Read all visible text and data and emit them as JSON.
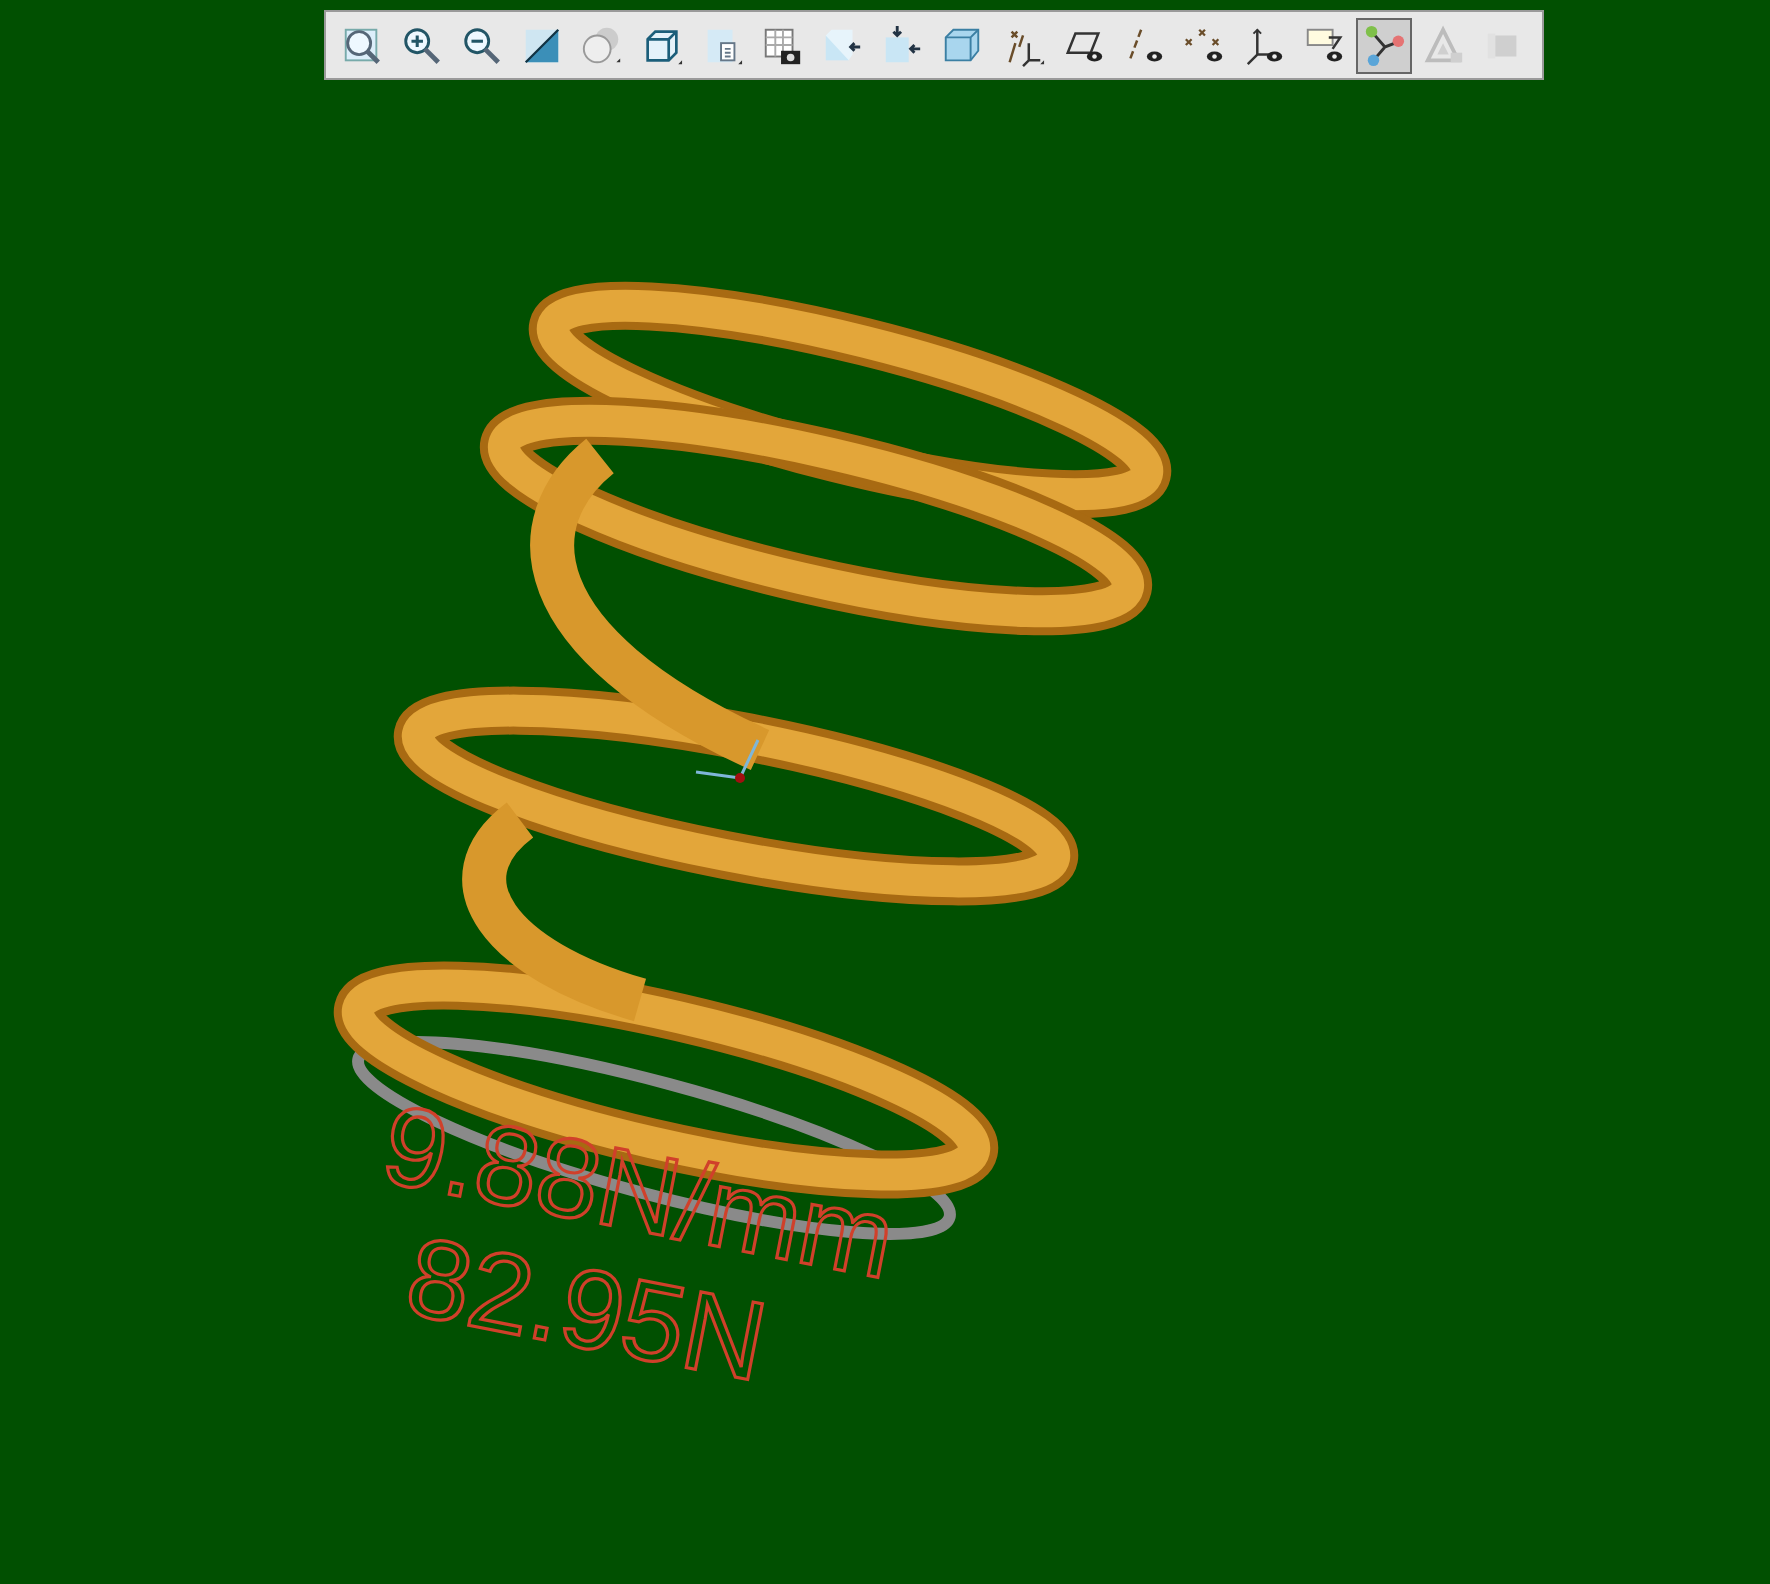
{
  "toolbar": {
    "buttons": [
      {
        "kind": "zoom-fit",
        "selected": false,
        "disabled": false
      },
      {
        "kind": "zoom-in",
        "selected": false,
        "disabled": false
      },
      {
        "kind": "zoom-out",
        "selected": false,
        "disabled": false
      },
      {
        "kind": "refit",
        "selected": false,
        "disabled": false
      },
      {
        "kind": "shading",
        "selected": false,
        "disabled": false
      },
      {
        "kind": "cube",
        "selected": false,
        "disabled": false
      },
      {
        "kind": "page",
        "selected": false,
        "disabled": false
      },
      {
        "kind": "table-camera",
        "selected": false,
        "disabled": false
      },
      {
        "kind": "cube-arrow",
        "selected": false,
        "disabled": false
      },
      {
        "kind": "cube-arrows",
        "selected": false,
        "disabled": false
      },
      {
        "kind": "glass-cube",
        "selected": false,
        "disabled": false
      },
      {
        "kind": "axes",
        "selected": false,
        "disabled": false
      },
      {
        "kind": "plane-eye",
        "selected": false,
        "disabled": false
      },
      {
        "kind": "axis-eye",
        "selected": false,
        "disabled": false
      },
      {
        "kind": "points-eye",
        "selected": false,
        "disabled": false
      },
      {
        "kind": "csys-eye",
        "selected": false,
        "disabled": false
      },
      {
        "kind": "note-eye",
        "selected": false,
        "disabled": false
      },
      {
        "kind": "node-link",
        "selected": true,
        "disabled": false
      },
      {
        "kind": "triangle",
        "selected": false,
        "disabled": true
      },
      {
        "kind": "block",
        "selected": false,
        "disabled": true
      }
    ]
  },
  "annotations": [
    {
      "text": "9.88N/mm"
    },
    {
      "text": "82.95N"
    }
  ]
}
